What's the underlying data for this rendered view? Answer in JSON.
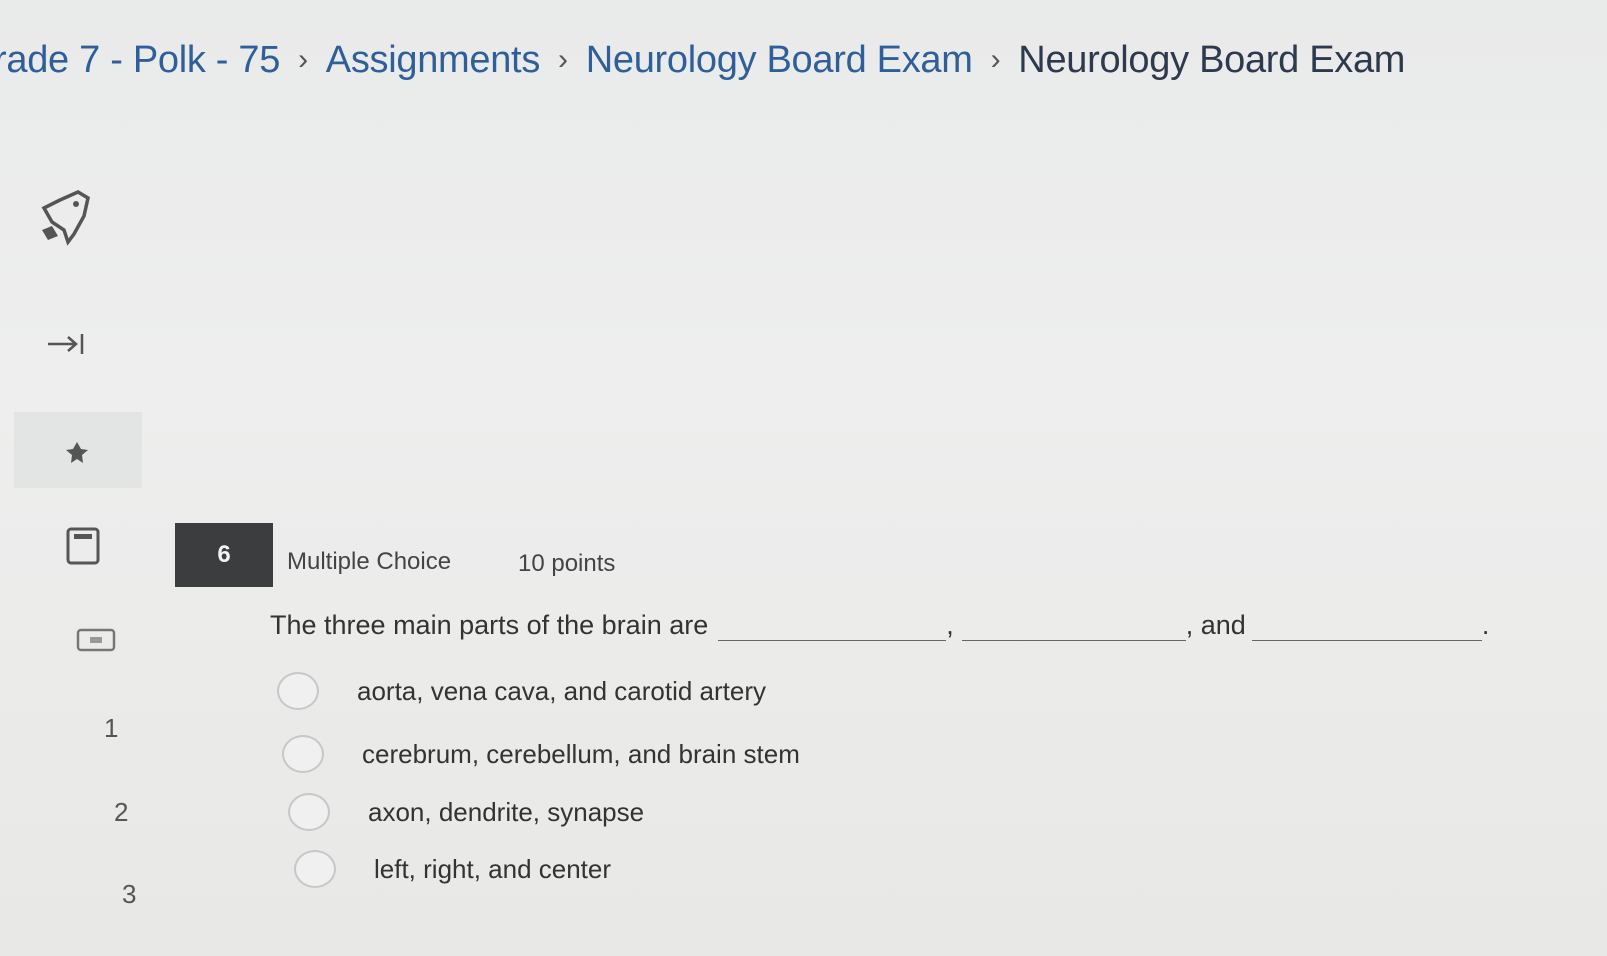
{
  "breadcrumb": {
    "course": "rade 7 - Polk - 75",
    "assignments": "Assignments",
    "exam_parent": "Neurology Board Exam",
    "exam_current": "Neurology Board Exam",
    "separator": "›"
  },
  "sidebar": {
    "icons": [
      "rocket-icon",
      "collapse-arrow-icon",
      "pin-icon",
      "calculator-icon",
      "notes-icon"
    ]
  },
  "question_nav": {
    "numbers": [
      "1",
      "2",
      "3"
    ]
  },
  "question": {
    "number": "6",
    "type": "Multiple Choice",
    "points": "10 points",
    "stem_text": "The three main parts of the brain are",
    "stem_comma": ",",
    "stem_and": ", and",
    "stem_period": ".",
    "options": [
      "aorta, vena cava, and carotid artery",
      "cerebrum, cerebellum, and brain stem",
      "axon, dendrite, synapse",
      "left, right, and center"
    ]
  },
  "colors": {
    "link": "#2f5f9a",
    "badge_bg": "#3b3d3f",
    "page_bg": "#ebebeb"
  }
}
